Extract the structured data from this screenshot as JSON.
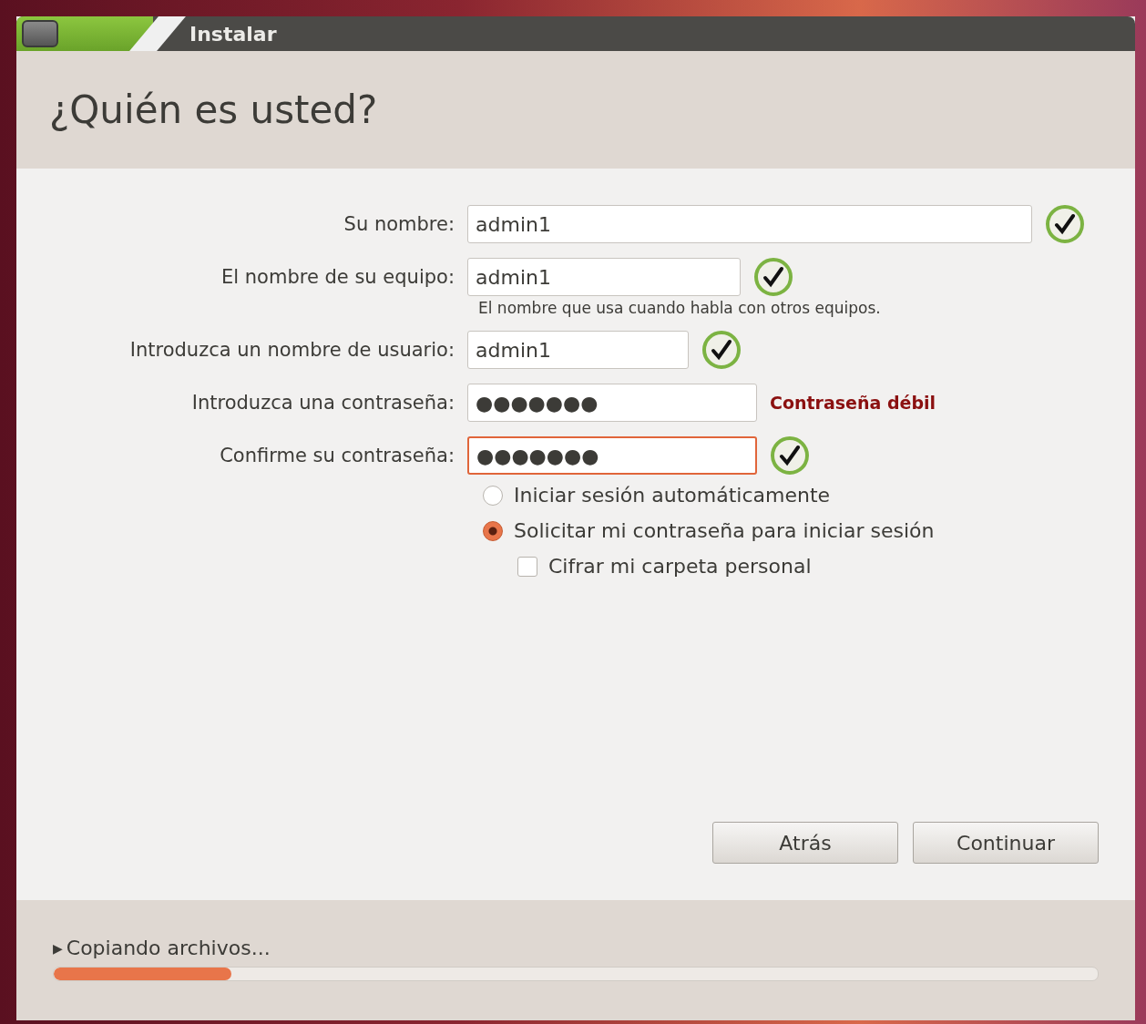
{
  "window": {
    "title": "Instalar"
  },
  "heading": "¿Quién es usted?",
  "fields": [
    {
      "label": "Su nombre:",
      "value": "admin1",
      "focused": false,
      "status": {
        "kind": "check"
      }
    },
    {
      "label": "El nombre de su equipo:",
      "value": "admin1",
      "focused": false,
      "status": {
        "kind": "check"
      },
      "hint": "El nombre que usa cuando habla con otros equipos."
    },
    {
      "label": "Introduzca un nombre de usuario:",
      "value": "admin1",
      "focused": false,
      "status": {
        "kind": "check"
      }
    },
    {
      "label": "Introduzca una contraseña:",
      "value": "●●●●●●●",
      "focused": false,
      "status": {
        "kind": "message",
        "text": "Contraseña débil"
      }
    },
    {
      "label": "Confirme su contraseña:",
      "value": "●●●●●●●",
      "focused": true,
      "status": {
        "kind": "check"
      }
    }
  ],
  "login_options": [
    {
      "label": "Iniciar sesión automáticamente",
      "selected": false
    },
    {
      "label": "Solicitar mi contraseña para iniciar sesión",
      "selected": true
    }
  ],
  "encrypt_home": {
    "label": "Cifrar mi carpeta personal",
    "checked": false
  },
  "buttons": [
    "Atrás",
    "Continuar"
  ],
  "progress": {
    "label": "Copiando archivos...",
    "expander": "▶",
    "level": 0.17
  }
}
